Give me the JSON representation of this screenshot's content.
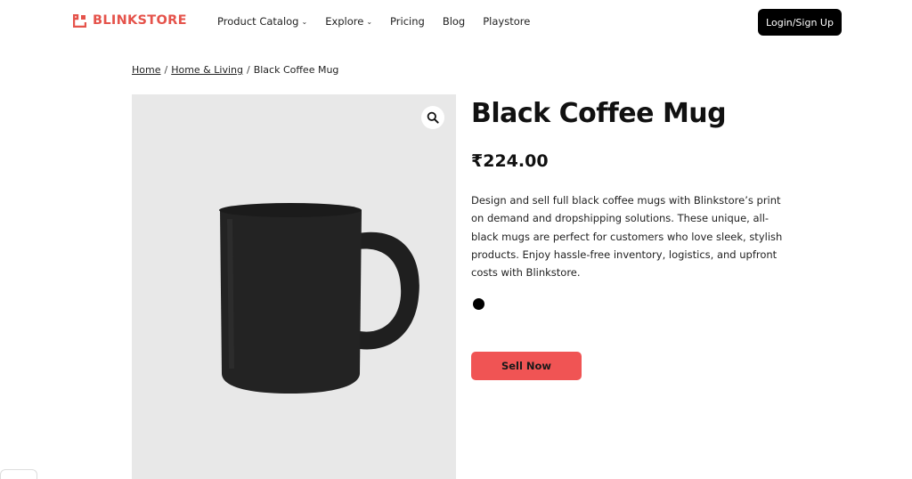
{
  "header": {
    "brand": "BLINKSTORE",
    "brand_color": "#e5534b",
    "nav": [
      {
        "label": "Product Catalog",
        "has_dropdown": true
      },
      {
        "label": "Explore",
        "has_dropdown": true
      },
      {
        "label": "Pricing",
        "has_dropdown": false
      },
      {
        "label": "Blog",
        "has_dropdown": false
      },
      {
        "label": "Playstore",
        "has_dropdown": false
      }
    ],
    "login_label": "Login/Sign Up"
  },
  "breadcrumb": {
    "items": [
      "Home",
      "Home & Living"
    ],
    "current": "Black Coffee Mug",
    "separator": "/"
  },
  "product": {
    "title": "Black Coffee Mug",
    "price": "₹224.00",
    "description": "Design and sell full black coffee mugs with Blinkstore’s print on demand and dropshipping solutions. These unique, all-black mugs are perfect for customers who love sleek, stylish products. Enjoy hassle-free inventory, logistics, and upfront costs with Blinkstore.",
    "color_swatch": "#000000",
    "image_icon": "zoom-icon",
    "sell_label": "Sell Now",
    "sell_color": "#f05454"
  }
}
